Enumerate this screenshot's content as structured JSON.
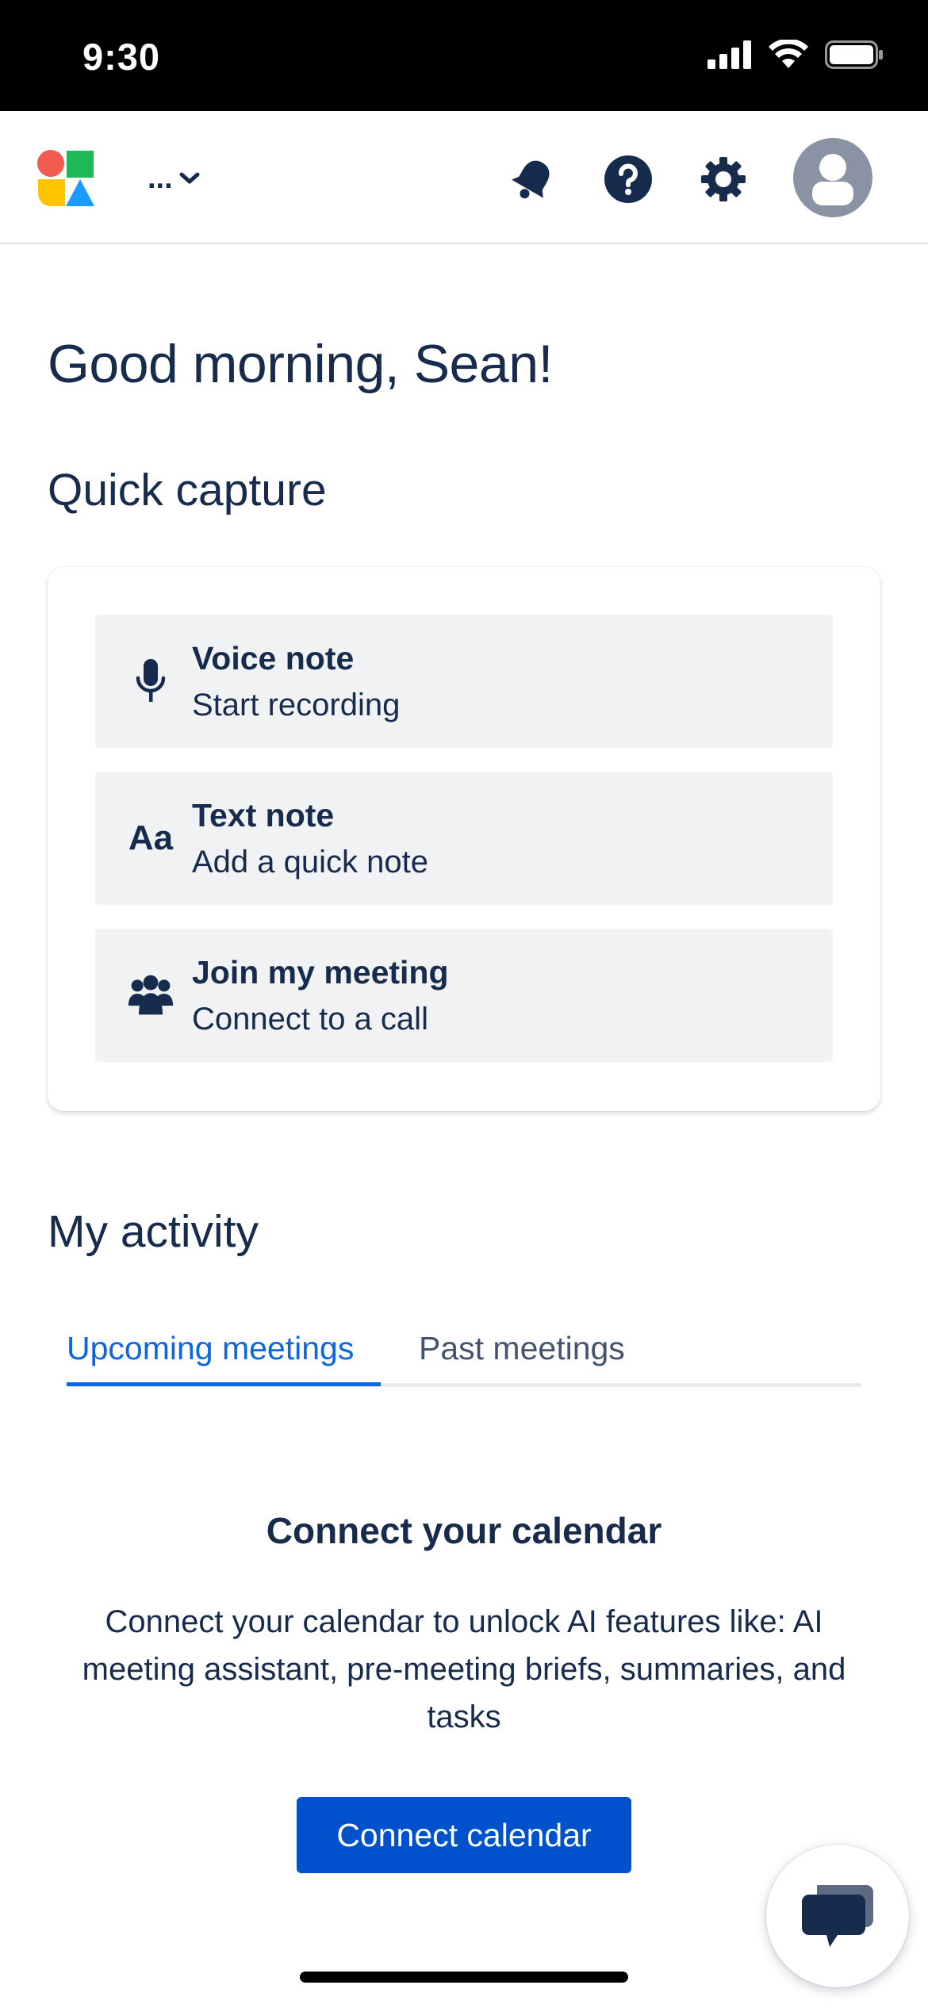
{
  "status_bar": {
    "time": "9:30"
  },
  "header": {
    "workspace_label": "...",
    "icons": [
      "notifications-icon",
      "help-icon",
      "settings-icon",
      "avatar"
    ]
  },
  "greeting": "Good morning, Sean!",
  "quick_capture": {
    "title": "Quick capture",
    "items": [
      {
        "icon": "microphone-icon",
        "title": "Voice note",
        "subtitle": "Start recording"
      },
      {
        "icon": "text-icon",
        "title": "Text note",
        "subtitle": "Add a quick note"
      },
      {
        "icon": "people-icon",
        "title": "Join my meeting",
        "subtitle": "Connect to a call"
      }
    ],
    "text_icon_glyph": "Aa"
  },
  "activity": {
    "title": "My activity",
    "tabs": [
      {
        "label": "Upcoming meetings",
        "active": true
      },
      {
        "label": "Past meetings",
        "active": false
      }
    ],
    "empty_state": {
      "title": "Connect your calendar",
      "description": "Connect your calendar to unlock AI features like: AI meeting assistant, pre-meeting briefs, summaries, and tasks",
      "button_label": "Connect calendar"
    }
  },
  "colors": {
    "primary": "#0052cc",
    "tab_active": "#0c66e4",
    "text": "#172b4d",
    "item_bg": "#f1f2f4"
  }
}
